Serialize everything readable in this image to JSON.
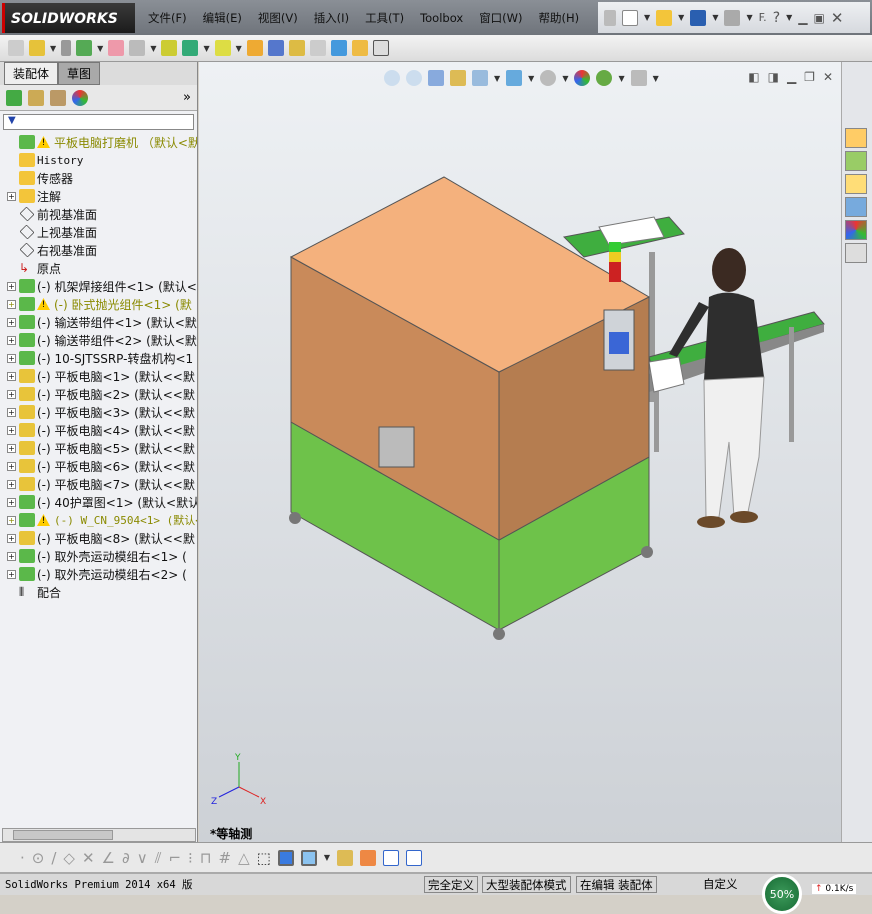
{
  "app": {
    "logo": "SOLIDWORKS"
  },
  "menu": [
    "文件(F)",
    "编辑(E)",
    "视图(V)",
    "插入(I)",
    "工具(T)",
    "Toolbox",
    "窗口(W)",
    "帮助(H)"
  ],
  "quick_access": {
    "extra_label": "F."
  },
  "left_panel": {
    "tabs": [
      "装配体",
      "草图"
    ],
    "tree": [
      {
        "label": "平板电脑打磨机 （默认<默认",
        "expand": false,
        "warn": true,
        "style": "yellow",
        "icon": "assembly"
      },
      {
        "label": "History",
        "expand": false,
        "icon": "history",
        "mono": true
      },
      {
        "label": "传感器",
        "expand": false,
        "icon": "sensor"
      },
      {
        "label": "注解",
        "expand": true,
        "icon": "annotation"
      },
      {
        "label": "前视基准面",
        "expand": false,
        "icon": "plane"
      },
      {
        "label": "上视基准面",
        "expand": false,
        "icon": "plane"
      },
      {
        "label": "右视基准面",
        "expand": false,
        "icon": "plane"
      },
      {
        "label": "原点",
        "expand": false,
        "icon": "origin"
      },
      {
        "label": "(-) 机架焊接组件<1> (默认<",
        "expand": true,
        "icon": "assembly"
      },
      {
        "label": "(-) 卧式抛光组件<1> (默",
        "expand": true,
        "warn": true,
        "style": "yellow",
        "icon": "assembly"
      },
      {
        "label": "(-) 输送带组件<1> (默认<默",
        "expand": true,
        "icon": "assembly"
      },
      {
        "label": "(-) 输送带组件<2> (默认<默",
        "expand": true,
        "icon": "assembly"
      },
      {
        "label": "(-) 10-SJTSSRP-转盘机构<1",
        "expand": true,
        "icon": "assembly"
      },
      {
        "label": "(-) 平板电脑<1> (默认<<默",
        "expand": true,
        "icon": "part"
      },
      {
        "label": "(-) 平板电脑<2> (默认<<默",
        "expand": true,
        "icon": "part"
      },
      {
        "label": "(-) 平板电脑<3> (默认<<默",
        "expand": true,
        "icon": "part"
      },
      {
        "label": "(-) 平板电脑<4> (默认<<默",
        "expand": true,
        "icon": "part"
      },
      {
        "label": "(-) 平板电脑<5> (默认<<默",
        "expand": true,
        "icon": "part"
      },
      {
        "label": "(-) 平板电脑<6> (默认<<默",
        "expand": true,
        "icon": "part"
      },
      {
        "label": "(-) 平板电脑<7> (默认<<默",
        "expand": true,
        "icon": "part"
      },
      {
        "label": "(-) 40护罩图<1> (默认<默认",
        "expand": true,
        "icon": "assembly"
      },
      {
        "label": "(-) W_CN_9504<1> (默认<",
        "expand": true,
        "warn": true,
        "style": "yellow",
        "icon": "assembly",
        "mono": true
      },
      {
        "label": "(-) 平板电脑<8> (默认<<默",
        "expand": true,
        "icon": "part"
      },
      {
        "label": "(-) 取外壳运动模组右<1> (",
        "expand": true,
        "icon": "assembly"
      },
      {
        "label": "(-) 取外壳运动模组右<2> (",
        "expand": true,
        "icon": "assembly"
      },
      {
        "label": "配合",
        "expand": false,
        "icon": "mates"
      }
    ]
  },
  "viewport": {
    "view_name": "*等轴测",
    "triad": {
      "x": "X",
      "y": "Y",
      "z": "Z"
    }
  },
  "status": {
    "product": "SolidWorks Premium 2014 x64 版",
    "fully_defined": "完全定义",
    "large_assembly": "大型装配体模式",
    "editing": "在编辑 装配体",
    "custom": "自定义"
  },
  "tray": {
    "percent": "50%",
    "speed": "0.1K/s"
  }
}
